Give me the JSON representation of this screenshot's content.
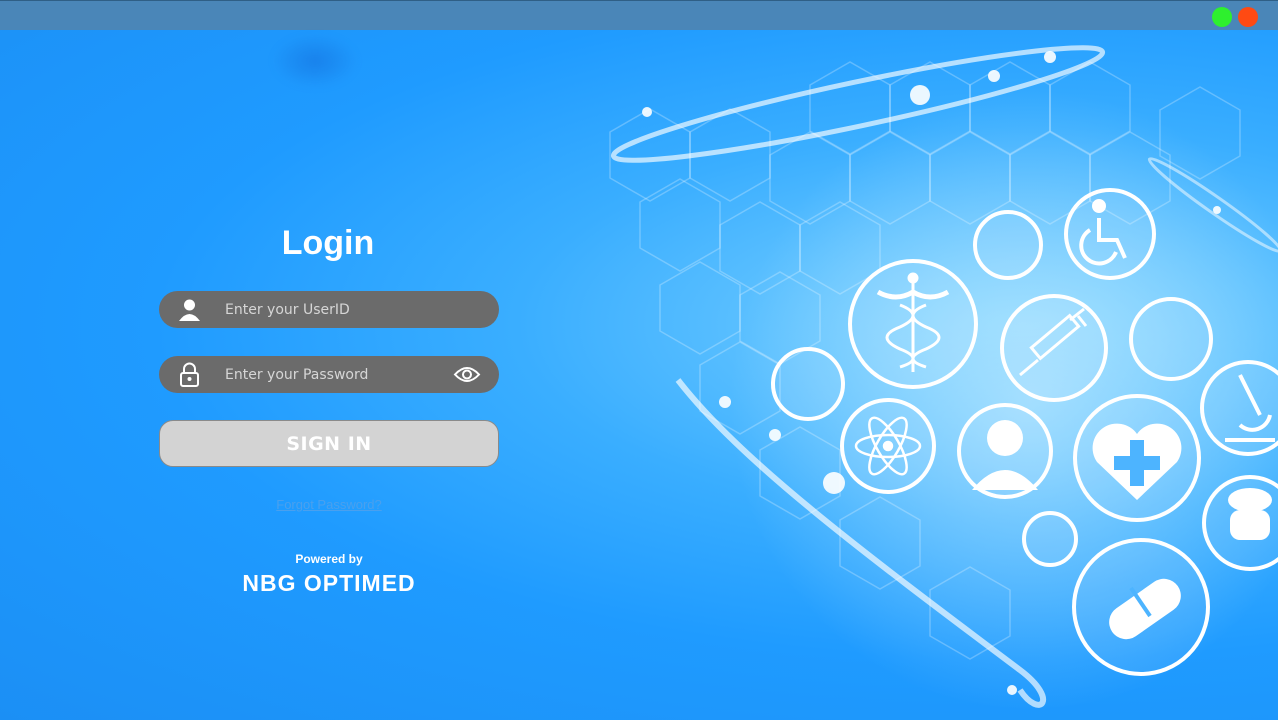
{
  "window": {
    "controls": [
      {
        "name": "maximize",
        "color": "#2ef02e"
      },
      {
        "name": "close",
        "color": "#ff4a12"
      }
    ]
  },
  "login": {
    "title": "Login",
    "userid_placeholder": "Enter your UserID",
    "password_placeholder": "Enter your Password",
    "signin_label": "SIGN IN",
    "forgot_label": "Forgot Password?",
    "powered_by": "Powered by",
    "brand": "NBG OPTIMED"
  },
  "icons": {
    "user": "user-icon",
    "lock": "lock-icon",
    "eye": "eye-icon",
    "medical": [
      "caduceus-icon",
      "syringe-icon",
      "wheelchair-icon",
      "atom-icon",
      "person-icon",
      "heart-cross-icon",
      "microscope-icon",
      "pill-icon",
      "doctor-icon"
    ]
  },
  "colors": {
    "background": "#1f9bff",
    "titlebar": "#4a86b8",
    "field": "#6b6b6b",
    "button": "#d3d3d3"
  }
}
